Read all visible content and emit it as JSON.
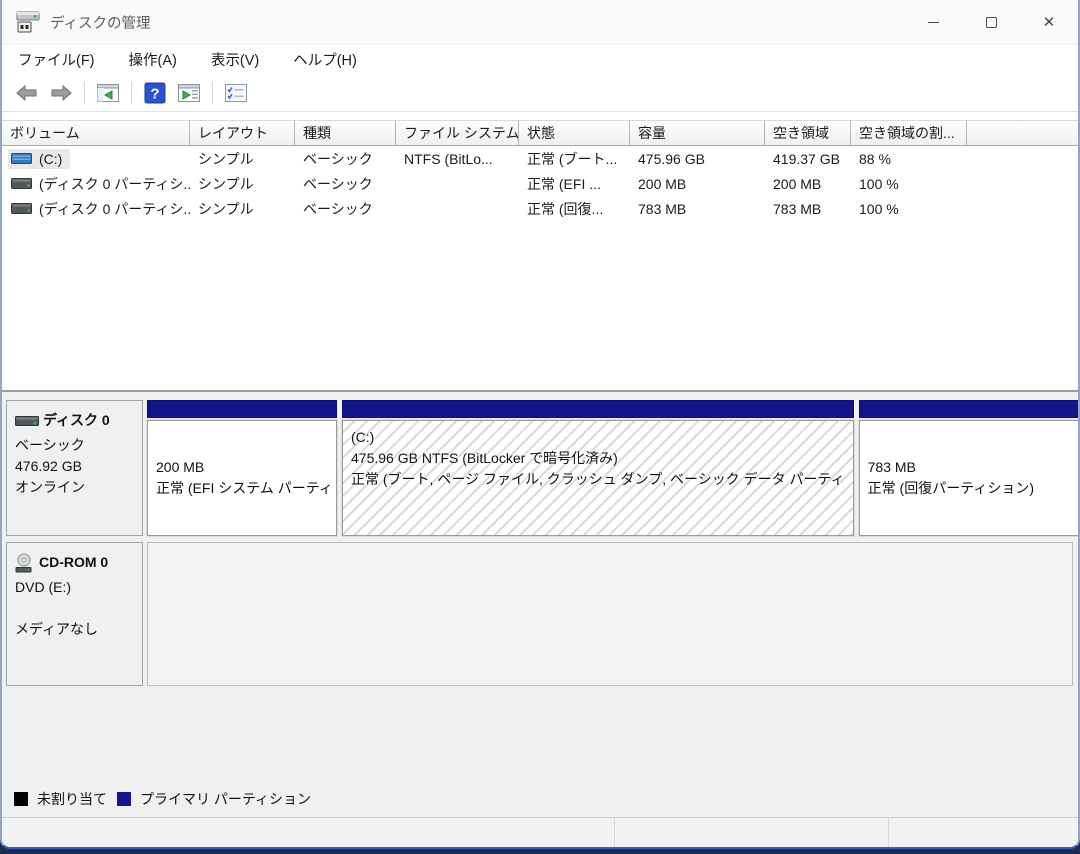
{
  "window": {
    "title": "ディスクの管理"
  },
  "menu": {
    "items": [
      {
        "label": "ファイル(F)"
      },
      {
        "label": "操作(A)"
      },
      {
        "label": "表示(V)"
      },
      {
        "label": "ヘルプ(H)"
      }
    ]
  },
  "toolbar": {
    "icons": [
      "back-icon",
      "forward-icon",
      "console-tree-icon",
      "help-icon",
      "action-pane-icon",
      "properties-icon"
    ]
  },
  "volume_table": {
    "columns": [
      {
        "label": "ボリューム"
      },
      {
        "label": "レイアウト"
      },
      {
        "label": "種類"
      },
      {
        "label": "ファイル システム"
      },
      {
        "label": "状態"
      },
      {
        "label": "容量"
      },
      {
        "label": "空き領域"
      },
      {
        "label": "空き領域の割..."
      }
    ],
    "rows": [
      {
        "volume": "(C:)",
        "layout": "シンプル",
        "type": "ベーシック",
        "filesystem": "NTFS (BitLo...",
        "status": "正常 (ブート...",
        "capacity": "475.96 GB",
        "free_space": "419.37 GB",
        "free_pct": "88 %"
      },
      {
        "volume": "(ディスク 0 パーティシ...",
        "layout": "シンプル",
        "type": "ベーシック",
        "filesystem": "",
        "status": "正常 (EFI ...",
        "capacity": "200 MB",
        "free_space": "200 MB",
        "free_pct": "100 %"
      },
      {
        "volume": "(ディスク 0 パーティシ...",
        "layout": "シンプル",
        "type": "ベーシック",
        "filesystem": "",
        "status": "正常 (回復...",
        "capacity": "783 MB",
        "free_space": "783 MB",
        "free_pct": "100 %"
      }
    ]
  },
  "disk0": {
    "name": "ディスク 0",
    "type": "ベーシック",
    "size": "476.92 GB",
    "status": "オンライン",
    "partitions": [
      {
        "size_line": "200 MB",
        "status_line": "正常 (EFI システム パーティ"
      },
      {
        "name": "(C:)",
        "size_line": "475.96 GB NTFS (BitLocker で暗号化済み)",
        "status_line": "正常 (ブート, ページ ファイル, クラッシュ ダンプ, ベーシック データ パーティ"
      },
      {
        "size_line": "783 MB",
        "status_line": "正常 (回復パーティション)"
      }
    ]
  },
  "cdrom": {
    "name": "CD-ROM 0",
    "drive": "DVD (E:)",
    "media_status": "メディアなし"
  },
  "legend": {
    "items": [
      {
        "label": "未割り当て",
        "color": "#000000"
      },
      {
        "label": "プライマリ パーティション",
        "color": "#15158a"
      }
    ]
  },
  "colors": {
    "partition_header": "#15158a",
    "window_bottom_accent": "#3c5fc0"
  }
}
